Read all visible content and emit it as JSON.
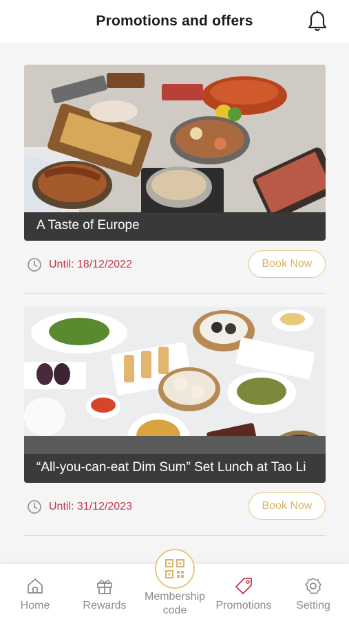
{
  "header": {
    "title": "Promotions and offers",
    "bell_icon": "bell-icon"
  },
  "promotions": [
    {
      "title": "A Taste of Europe",
      "until": "Until: 18/12/2022",
      "book_label": "Book Now"
    },
    {
      "title": "“All-you-can-eat Dim Sum”  Set Lunch at Tao Li",
      "until": "Until: 31/12/2023",
      "book_label": "Book Now"
    }
  ],
  "tabbar": {
    "items": [
      {
        "label": "Home",
        "icon": "home-icon"
      },
      {
        "label": "Rewards",
        "icon": "gift-icon"
      },
      {
        "label": "Membership code",
        "icon": "qr-code-icon"
      },
      {
        "label": "Promotions",
        "icon": "tag-icon",
        "active": true
      },
      {
        "label": "Setting",
        "icon": "gear-icon"
      }
    ]
  },
  "colors": {
    "accent": "#e7c779",
    "date": "#c0364a",
    "text_muted": "#8c8c8c"
  }
}
